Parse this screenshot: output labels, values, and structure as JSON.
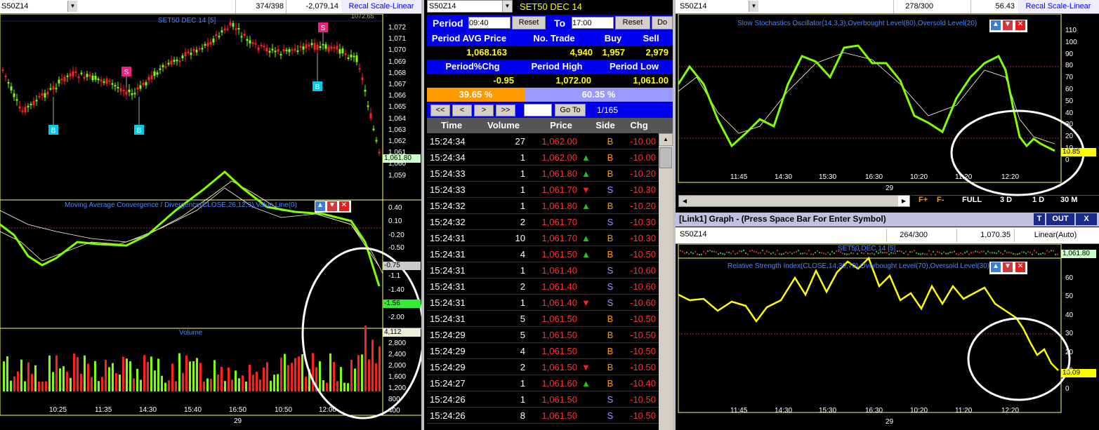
{
  "colors": {
    "green": "#80ff00",
    "red": "#ff2020",
    "yellow": "#ffff00",
    "axis": "#ffff66",
    "bluetitle": "#4a88ff"
  },
  "left": {
    "symbol": "S50Z14",
    "count": "374/398",
    "change": "-2,079.14",
    "recal": "Recal Scale-Linear",
    "price_top": "1072.65",
    "title": "SET50 DEC 14",
    "title_tag": "[5]",
    "price_axis": [
      "1,072",
      "1,071",
      "1,070",
      "1,069",
      "1,068",
      "1,067",
      "1,066",
      "1,065",
      "1,064",
      "1,063",
      "1,062",
      "1,061",
      "1,060",
      "1,059"
    ],
    "last_price": "1,061.80",
    "markers": [
      "B",
      "B",
      "S",
      "S",
      "B"
    ],
    "macd_title": "Moving Average Convergence / Divergence(CLOSE,26,12,9),Value Line(0)",
    "macd_axis": [
      "0.40",
      "0.10",
      "-0.20",
      "-0.50",
      "-1.1",
      "-1.40",
      "-2.00"
    ],
    "macd_val1": "-0.75",
    "macd_val2": "-1.56",
    "vol_title": "Volume",
    "vol_axis": [
      "2,800",
      "2,400",
      "2,000",
      "1,600",
      "1,200",
      "800",
      "400"
    ],
    "vol_last": "4,112",
    "times": [
      "10:25",
      "11:35",
      "14:30",
      "15:40",
      "16:50",
      "10:50",
      "12:00"
    ],
    "date": "29"
  },
  "middle": {
    "symbol": "S50Z14",
    "title": "SET50 DEC 14",
    "period_label": "Period",
    "period_from": "09:40",
    "reset": "Reset",
    "to": "To",
    "period_to": "17:00",
    "reset2": "Reset",
    "do": "Do",
    "h1": [
      "Period AVG Price",
      "No. Trade",
      "Buy",
      "Sell"
    ],
    "v1": [
      "1,068.163",
      "4,940",
      "1,957",
      "2,979"
    ],
    "h2": [
      "Period%Chg",
      "Period High",
      "Period Low"
    ],
    "v2": [
      "-0.95",
      "1,072.00",
      "1,061.00"
    ],
    "buy_pct": "39.65 %",
    "sell_pct": "60.35 %",
    "nav": [
      "<<",
      "<",
      ">",
      ">>"
    ],
    "goto": "Go To",
    "page": "1/165",
    "cols": [
      "Time",
      "Volume",
      "Price",
      "Side",
      "Chg"
    ],
    "rows": [
      {
        "t": "15:24:34",
        "v": "27",
        "p": "1,062.00",
        "a": "",
        "s": "B",
        "c": "-10.00"
      },
      {
        "t": "15:24:34",
        "v": "1",
        "p": "1,062.00",
        "a": "up",
        "s": "B",
        "c": "-10.00"
      },
      {
        "t": "15:24:33",
        "v": "1",
        "p": "1,061.80",
        "a": "up",
        "s": "B",
        "c": "-10.20"
      },
      {
        "t": "15:24:33",
        "v": "1",
        "p": "1,061.70",
        "a": "down",
        "s": "S",
        "c": "-10.30"
      },
      {
        "t": "15:24:32",
        "v": "1",
        "p": "1,061.80",
        "a": "up",
        "s": "B",
        "c": "-10.20"
      },
      {
        "t": "15:24:32",
        "v": "2",
        "p": "1,061.70",
        "a": "",
        "s": "S",
        "c": "-10.30"
      },
      {
        "t": "15:24:31",
        "v": "10",
        "p": "1,061.70",
        "a": "up",
        "s": "B",
        "c": "-10.30"
      },
      {
        "t": "15:24:31",
        "v": "4",
        "p": "1,061.50",
        "a": "up",
        "s": "B",
        "c": "-10.50"
      },
      {
        "t": "15:24:31",
        "v": "1",
        "p": "1,061.40",
        "a": "",
        "s": "S",
        "c": "-10.60"
      },
      {
        "t": "15:24:31",
        "v": "2",
        "p": "1,061.40",
        "a": "",
        "s": "S",
        "c": "-10.60"
      },
      {
        "t": "15:24:31",
        "v": "1",
        "p": "1,061.40",
        "a": "down",
        "s": "S",
        "c": "-10.60"
      },
      {
        "t": "15:24:31",
        "v": "5",
        "p": "1,061.50",
        "a": "",
        "s": "B",
        "c": "-10.50"
      },
      {
        "t": "15:24:29",
        "v": "5",
        "p": "1,061.50",
        "a": "",
        "s": "B",
        "c": "-10.50"
      },
      {
        "t": "15:24:29",
        "v": "4",
        "p": "1,061.50",
        "a": "",
        "s": "B",
        "c": "-10.50"
      },
      {
        "t": "15:24:29",
        "v": "2",
        "p": "1,061.50",
        "a": "down",
        "s": "B",
        "c": "-10.50"
      },
      {
        "t": "15:24:27",
        "v": "1",
        "p": "1,061.60",
        "a": "up",
        "s": "B",
        "c": "-10.40"
      },
      {
        "t": "15:24:26",
        "v": "1",
        "p": "1,061.50",
        "a": "",
        "s": "S",
        "c": "-10.50"
      },
      {
        "t": "15:24:26",
        "v": "8",
        "p": "1,061.50",
        "a": "",
        "s": "S",
        "c": "-10.50"
      }
    ]
  },
  "topright": {
    "symbol": "S50Z14",
    "count": "278/300",
    "change": "56.43",
    "recal": "Recal Scale-Linear",
    "title": "Slow Stochastics Oscillator(14,3,3),Overbought Level(80),Oversold Level(20)",
    "axis": [
      "110",
      "100",
      "90",
      "80",
      "70",
      "60",
      "50",
      "40",
      "30",
      "20",
      "10",
      "0"
    ],
    "value": "10.85",
    "times": [
      "11:45",
      "14:30",
      "15:30",
      "16:30",
      "10:20",
      "11:20",
      "12:20"
    ],
    "date": "29",
    "toolbar": [
      "F+",
      "F-",
      "FULL",
      "3 D",
      "1 D",
      "30 M"
    ]
  },
  "bottomright": {
    "title": "[Link1] Graph  - (Press Space Bar For Enter Symbol)",
    "t_btn": "T",
    "out_btn": "OUT",
    "x_btn": "X",
    "symbol": "S50Z14",
    "count": "264/300",
    "change": "1,070.35",
    "scale": "Linear(Auto)",
    "subtitle": "SET50 DEC 14",
    "subtitle_tag": "[5]",
    "price": "1,061.80",
    "rsi_title": "Relative Strength Index(CLOSE,14,30,70),Overbought Level(70),Oversold Level(30)",
    "axis": [
      "60",
      "50",
      "40",
      "30",
      "20",
      "10",
      "0"
    ],
    "value": "10.09",
    "times": [
      "11:45",
      "14:30",
      "15:30",
      "16:30",
      "10:20",
      "11:20",
      "12:20"
    ],
    "date": "29"
  }
}
